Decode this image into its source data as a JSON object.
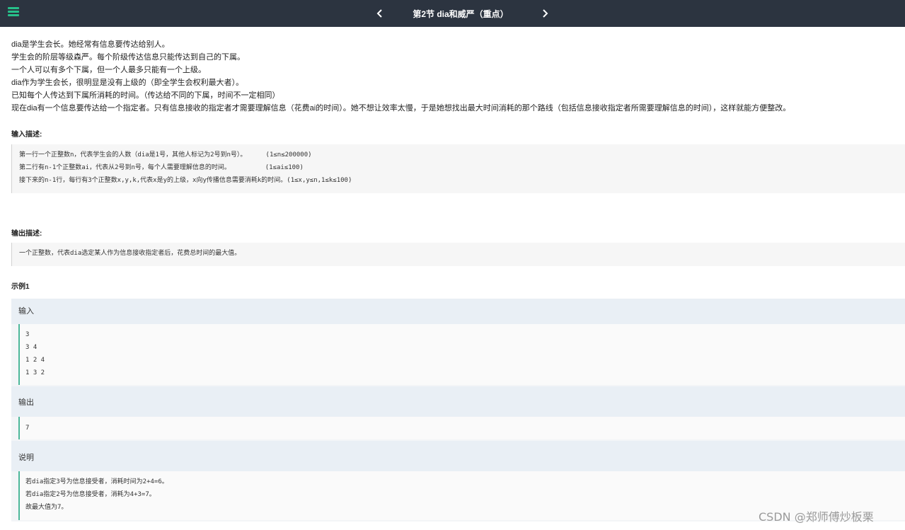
{
  "header": {
    "title": "第2节 dia和威严（重点）",
    "menu_icon": "hamburger-menu-icon",
    "prev_icon": "chevron-left-icon",
    "next_icon": "chevron-right-icon"
  },
  "description": [
    "dia是学生会长。她经常有信息要传达给别人。",
    "学生会的阶层等级森严。每个阶级传达信息只能传达到自己的下属。",
    "一个人可以有多个下属，但一个人最多只能有一个上级。",
    "dia作为学生会长，很明显是没有上级的（即全学生会权利最大者）。",
    "已知每个人传达到下属所消耗的时间。（传达给不同的下属，时间不一定相同）",
    "现在dia有一个信息要传达给一个指定者。只有信息接收的指定者才需要理解信息（花费ai的时间）。她不想让效率太慢，于是她想找出最大时间消耗的那个路线（包括信息接收指定者所需要理解信息的时间），这样就能方便整改。"
  ],
  "input_section": {
    "title": "输入描述:",
    "lines": [
      "第一行一个正整数n，代表学生会的人数（dia是1号，其他人标记为2号到n号）。     (1≤n≤200000)",
      "第二行有n-1个正整数ai，代表从2号到n号，每个人需要理解信息的时间。         (1≤ai≤100)",
      "接下来的n-1行，每行有3个正整数x,y,k,代表x是y的上级，x向y传播信息需要消耗k的时间。(1≤x,y≤n,1≤k≤100)"
    ]
  },
  "output_section": {
    "title": "输出描述:",
    "lines": [
      "一个正整数，代表dia选定某人作为信息接收指定者后，花费总时间的最大值。"
    ]
  },
  "example": {
    "title": "示例1",
    "input_label": "输入",
    "input_lines": [
      "3",
      "3 4",
      "1 2 4",
      "1 3 2"
    ],
    "output_label": "输出",
    "output_lines": [
      "7"
    ],
    "explain_label": "说明",
    "explain_lines": [
      "若dia指定3号为信息接受者，消耗时间为2+4=6。",
      "若dia指定2号为信息接受者，消耗为4+3=7。",
      "故最大值为7。"
    ]
  },
  "watermark": "CSDN @郑师傅炒板栗"
}
